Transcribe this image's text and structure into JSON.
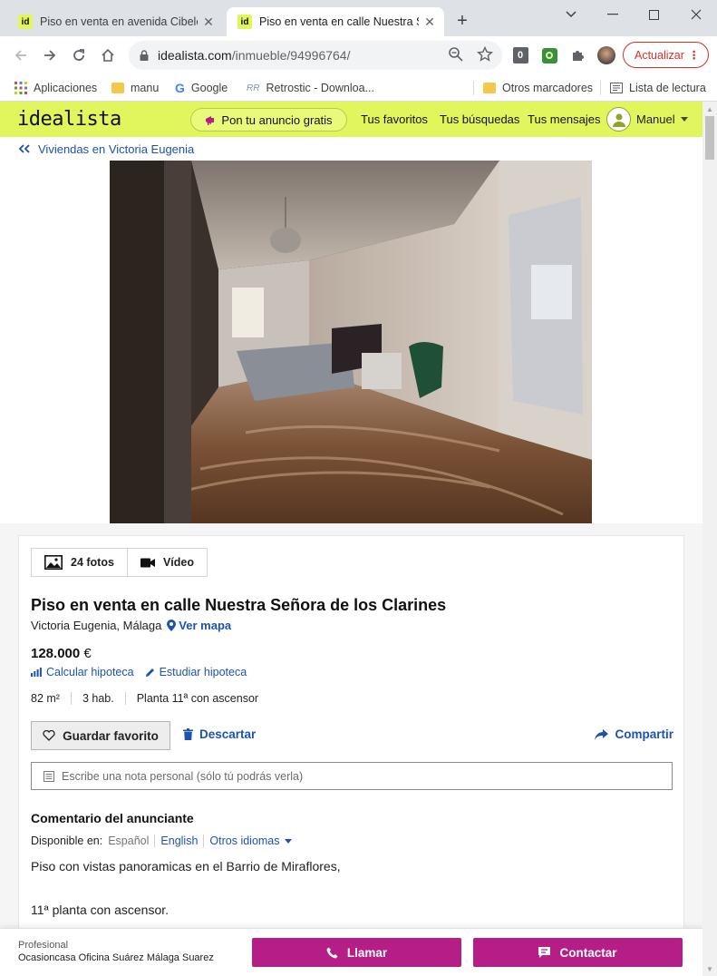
{
  "browser": {
    "tabs": [
      {
        "title": "Piso en venta en avenida Cibeles",
        "favicon": "id",
        "active": false
      },
      {
        "title": "Piso en venta en calle Nuestra Se",
        "favicon": "id",
        "active": true
      }
    ],
    "new_tab": "+",
    "address": {
      "domain": "idealista.com",
      "path": "/inmueble/94996764/"
    },
    "update_label": "Actualizar",
    "update_menu": "⋮",
    "profile_badge": "0",
    "bookmarks": [
      {
        "label": "Aplicaciones",
        "icon": "apps-grid-icon"
      },
      {
        "label": "manu",
        "icon": "folder-icon"
      },
      {
        "label": "Google",
        "icon": "google-icon"
      },
      {
        "label": "Retrostic - Downloa...",
        "icon": "retrostic-icon"
      },
      {
        "label": "Otros marcadores",
        "icon": "folder-icon"
      },
      {
        "label": "Lista de lectura",
        "icon": "reading-list-icon"
      }
    ]
  },
  "site": {
    "logo": "idealista",
    "publish_label": "Pon tu anuncio gratis",
    "nav": [
      "Tus favoritos",
      "Tus búsquedas",
      "Tus mensajes"
    ],
    "user_name": "Manuel",
    "breadcrumb": "Viviendas en Victoria Eugenia"
  },
  "listing": {
    "photos_label": "24 fotos",
    "video_label": "Vídeo",
    "title": "Piso en venta en calle Nuestra Señora de los Clarines",
    "location": "Victoria Eugenia, Málaga",
    "map_link": "Ver mapa",
    "price": "128.000",
    "currency": "€",
    "mortgage_calc": "Calcular hipoteca",
    "mortgage_study": "Estudiar hipoteca",
    "features": [
      "82 m²",
      "3 hab.",
      "Planta 11ª con ascensor"
    ],
    "favorite_label": "Guardar favorito",
    "discard_label": "Descartar",
    "share_label": "Compartir",
    "note_placeholder": "Escribe una nota personal (sólo tú podrás verla)",
    "comment_title": "Comentario del anunciante",
    "available_in_label": "Disponible en:",
    "languages": [
      "Español",
      "English",
      "Otros idiomas"
    ],
    "description": [
      "Piso con vistas panoramicas en el Barrio de Miraflores,",
      "11ª planta con ascensor."
    ]
  },
  "contact": {
    "type": "Profesional",
    "agency": "Ocasioncasa Oficina Suárez Málaga Suarez",
    "call_label": "Llamar",
    "contact_label": "Contactar"
  },
  "colors": {
    "brand_yellow": "#e1f55d",
    "link_blue": "#1c52b2",
    "contact_magenta": "#b41e86",
    "update_red": "#d93025"
  }
}
